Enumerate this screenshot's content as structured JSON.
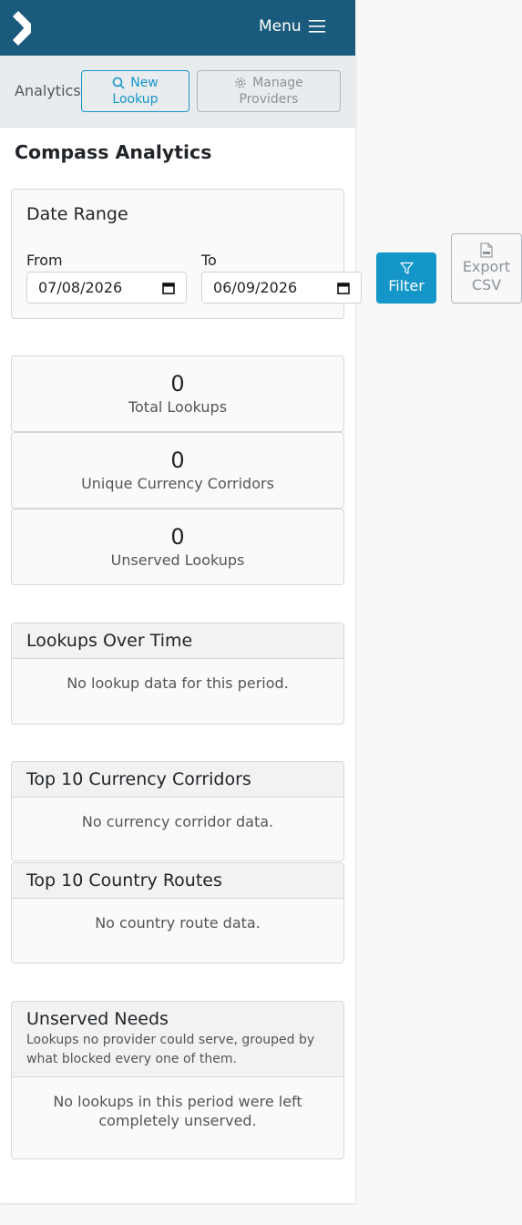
{
  "header": {
    "menu_label": "Menu"
  },
  "subnav": {
    "crumb": "Analytics",
    "new_lookup": [
      "New",
      "Lookup"
    ],
    "manage_providers": [
      "Manage",
      "Providers"
    ]
  },
  "page": {
    "title": "Compass Analytics"
  },
  "date_range": {
    "heading": "Date Range",
    "from_label": "From",
    "from_value": "07/08/2026",
    "to_label": "To",
    "to_value": "06/09/2026"
  },
  "actions": {
    "filter_label": "Filter",
    "export_label": [
      "Export",
      "CSV"
    ]
  },
  "stats": [
    {
      "value": "0",
      "label": "Total Lookups"
    },
    {
      "value": "0",
      "label": "Unique Currency Corridors"
    },
    {
      "value": "0",
      "label": "Unserved Lookups"
    }
  ],
  "panels": {
    "over_time": {
      "title": "Lookups Over Time",
      "empty": "No lookup data for this period."
    },
    "corridors": {
      "title": "Top 10 Currency Corridors",
      "empty": "No currency corridor data."
    },
    "routes": {
      "title": "Top 10 Country Routes",
      "empty": "No country route data."
    },
    "unserved": {
      "title": "Unserved Needs",
      "subtitle": [
        "Lookups no provider could serve, grouped by",
        "what blocked every one of them."
      ],
      "empty": [
        "No lookups in this period were left",
        "completely unserved."
      ]
    }
  },
  "colors": {
    "header_bg": "#1a5b7d",
    "accent": "#1596c9"
  }
}
